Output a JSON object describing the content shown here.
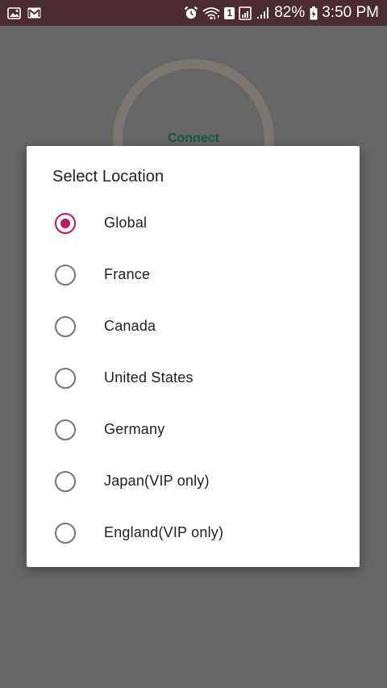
{
  "status_bar": {
    "left_icons": [
      "image-notification-icon",
      "gmail-notification-icon"
    ],
    "right_icons": [
      "alarm-icon",
      "wifi-icon",
      "sim-icon",
      "signal-icon"
    ],
    "sim_slot": "1",
    "battery_percent": "82%",
    "time": "3:50 PM"
  },
  "background_app": {
    "connect_label": "Connect"
  },
  "dialog": {
    "title": "Select Location",
    "selected_index": 0,
    "options": [
      {
        "label": "Global",
        "selected": true
      },
      {
        "label": "France",
        "selected": false
      },
      {
        "label": "Canada",
        "selected": false
      },
      {
        "label": "United States",
        "selected": false
      },
      {
        "label": "Germany",
        "selected": false
      },
      {
        "label": "Japan(VIP only)",
        "selected": false
      },
      {
        "label": "England(VIP only)",
        "selected": false
      }
    ]
  },
  "colors": {
    "status_bar_bg": "#4a2b2f",
    "scrim_bg": "#666666",
    "accent": "#c2185b",
    "radio_unchecked": "#757575",
    "text_primary": "#212121",
    "connect_text": "#0f5a48"
  }
}
